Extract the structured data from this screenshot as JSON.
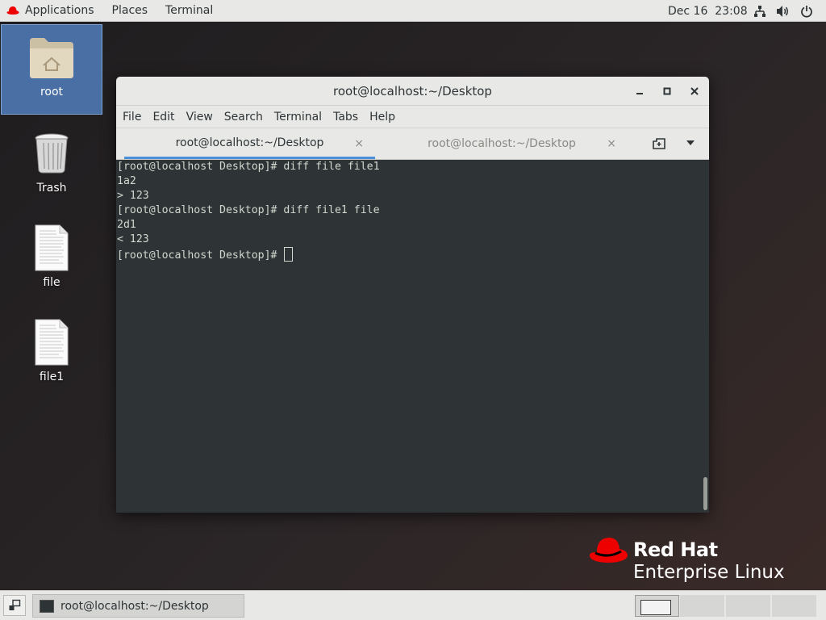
{
  "topbar": {
    "applications": "Applications",
    "places": "Places",
    "terminal": "Terminal",
    "clock": "Dec 16  23:08",
    "icons": [
      "network-icon",
      "volume-icon",
      "power-icon"
    ]
  },
  "desktop": {
    "icons": [
      {
        "label": "root",
        "type": "home-folder-icon"
      },
      {
        "label": "Trash",
        "type": "trash-icon"
      },
      {
        "label": "file",
        "type": "text-file-icon"
      },
      {
        "label": "file1",
        "type": "text-file-icon"
      }
    ]
  },
  "window": {
    "title": "root@localhost:~/Desktop",
    "menu": [
      "File",
      "Edit",
      "View",
      "Search",
      "Terminal",
      "Tabs",
      "Help"
    ],
    "tabs": [
      {
        "label": "root@localhost:~/Desktop",
        "active": true
      },
      {
        "label": "root@localhost:~/Desktop",
        "active": false
      }
    ],
    "close_glyph": "×"
  },
  "terminal": {
    "lines": [
      "[root@localhost Desktop]# diff file file1",
      "1a2",
      "> 123",
      "[root@localhost Desktop]# diff file1 file",
      "2d1",
      "< 123"
    ],
    "prompt": "[root@localhost Desktop]# "
  },
  "branding": {
    "line1": "Red Hat",
    "line2": "Enterprise Linux",
    "accent": "#ee0000"
  },
  "taskbar": {
    "task_label": "root@localhost:~/Desktop",
    "workspaces": 4,
    "active_workspace": 1
  },
  "colors": {
    "panel": "#e8e8e7",
    "terminal_bg": "#2e3436",
    "terminal_fg": "#d3d7cf",
    "tab_accent": "#4a90d9",
    "selection": "#4a6fa5"
  }
}
